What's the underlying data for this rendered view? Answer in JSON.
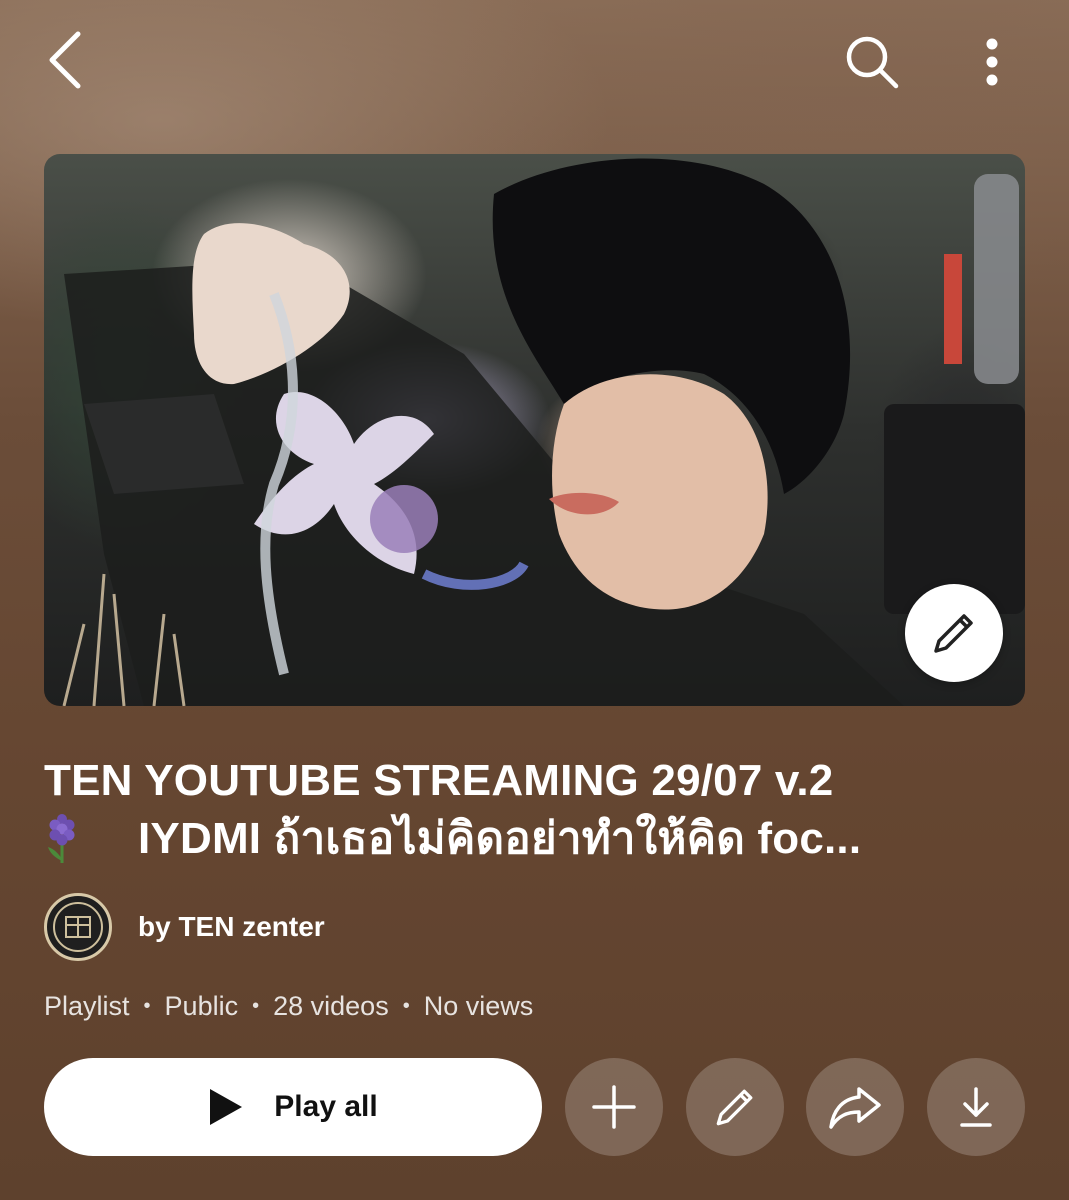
{
  "header": {
    "back_icon": "chevron-left-icon",
    "search_icon": "search-icon",
    "more_icon": "more-vertical-icon"
  },
  "thumbnail": {
    "edit_icon": "pencil-icon"
  },
  "playlist": {
    "title_line1": "TEN YOUTUBE STREAMING 29/07 v.2",
    "title_emoji_icon": "hyacinth-icon",
    "title_line2": "IYDMI ถ้าเธอไม่คิดอย่าทำให้คิด foc...",
    "owner": "by TEN zenter",
    "meta": [
      "Playlist",
      "Public",
      "28 videos",
      "No views"
    ]
  },
  "actions": {
    "play_all_label": "Play all",
    "add_icon": "plus-icon",
    "edit_icon": "pencil-icon",
    "share_icon": "share-arrow-icon",
    "download_icon": "download-icon"
  },
  "colors": {
    "background": "#6b4d39",
    "button_fill": "#ffffff",
    "round_button_fill": "rgba(255,255,255,0.2)"
  }
}
